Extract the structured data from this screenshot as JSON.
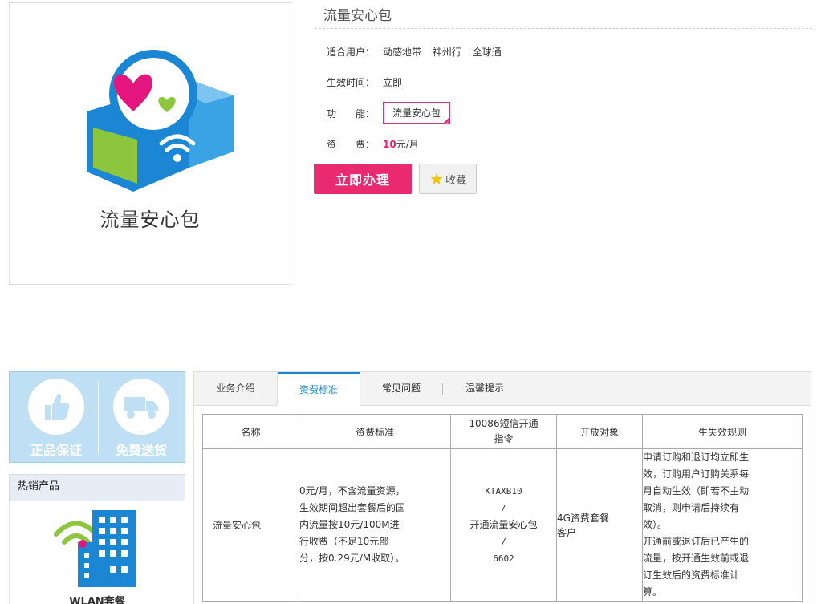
{
  "product": {
    "image_caption": "流量安心包",
    "title": "流量安心包"
  },
  "attributes": {
    "users_label": "适合用户：",
    "users": [
      "动感地带",
      "神州行",
      "全球通"
    ],
    "effective_label": "生效时间：",
    "effective_value": "立即",
    "function_label": "功　　能：",
    "function_value": "流量安心包",
    "fee_label": "资　　费：",
    "fee_number": "10",
    "fee_unit": "元/月"
  },
  "actions": {
    "buy": "立即办理",
    "favorite": "收藏"
  },
  "sidebar": {
    "promise_genuine": "正品保证",
    "promise_shipping": "免费送货",
    "hot_title": "热销产品",
    "hot_product": "WLAN套餐"
  },
  "tabs": [
    {
      "label": "业务介绍"
    },
    {
      "label": "资费标准"
    },
    {
      "label": "常见问题"
    },
    {
      "label": "温馨提示"
    }
  ],
  "fee_table": {
    "headers": [
      "名称",
      "资费标准",
      "10086短信开通指令",
      "开放对象",
      "生失效规则"
    ],
    "row": {
      "name": "流量安心包",
      "standard": "0元/月，不含流量资源，生效期间超出套餐后的国内流量按10元/100M进行收费（不足10元部分，按0.29元/M收取）。",
      "command_lines": [
        "KTAXB10",
        "/",
        "开通流量安心包",
        "/",
        "6602"
      ],
      "target": "4G资费套餐客户",
      "rule_1": "申请订购和退订均立即生效，订购用户订购关系每月自动生效（即若不主动取消，则申请后持续有效）。",
      "rule_2": "开通前或退订后已产生的流量，按开通生效前或退订生效后的资费标准计算。"
    }
  },
  "colors": {
    "accent_pink": "#e92a6e",
    "accent_blue": "#1b87d4"
  }
}
